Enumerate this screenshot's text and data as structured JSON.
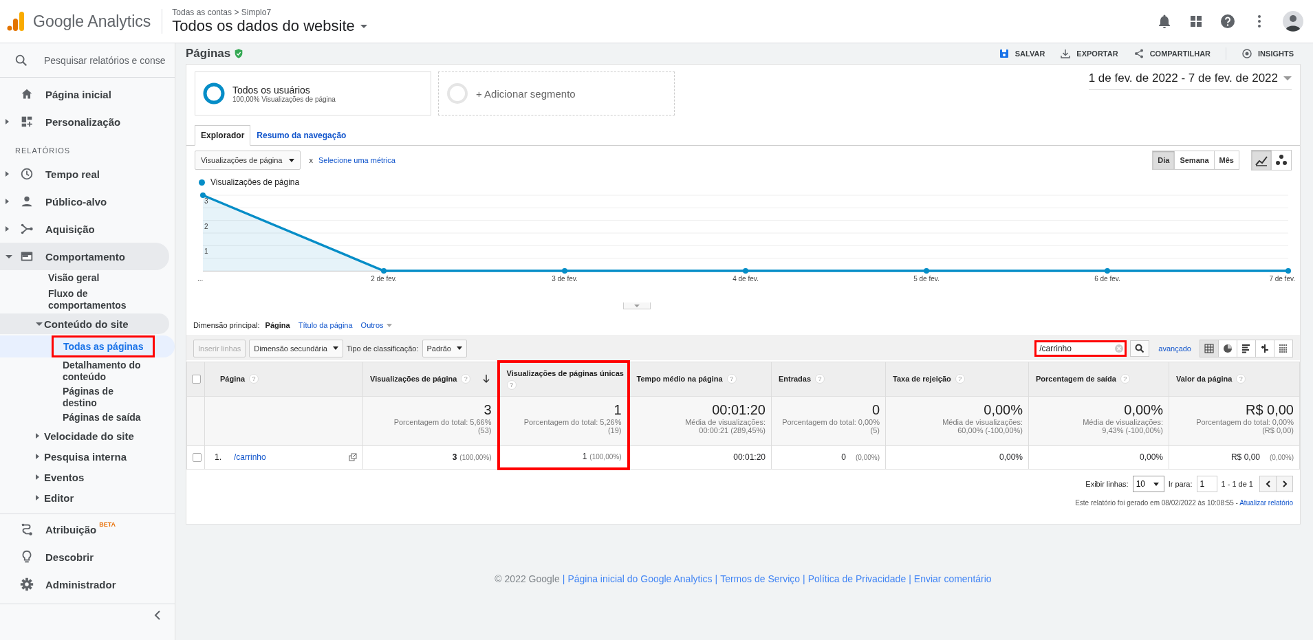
{
  "header": {
    "product": "Google Analytics",
    "breadcrumb": "Todas as contas > Simplo7",
    "view_title": "Todos os dados do website"
  },
  "sidebar": {
    "search": {
      "placeholder": "Pesquisar relatórios e conse"
    },
    "nav": [
      {
        "label": "Página inicial"
      },
      {
        "label": "Personalização",
        "expanded": false
      }
    ],
    "reports_heading": "RELATÓRIOS",
    "reports": [
      {
        "label": "Tempo real",
        "expanded": false
      },
      {
        "label": "Público-alvo",
        "expanded": false
      },
      {
        "label": "Aquisição",
        "expanded": false
      },
      {
        "label": "Comportamento",
        "expanded": true,
        "children": [
          {
            "label": "Visão geral",
            "selected": false
          },
          {
            "label": "Fluxo de comportamentos",
            "selected": false
          },
          {
            "label": "Conteúdo do site",
            "expanded": true,
            "children": [
              {
                "label": "Todas as páginas",
                "selected": true,
                "highlighted": true
              },
              {
                "label": "Detalhamento do conteúdo",
                "selected": false,
                "highlighted": false
              },
              {
                "label": "Páginas de destino",
                "selected": false,
                "highlighted": false
              },
              {
                "label": "Páginas de saída",
                "selected": false,
                "highlighted": false
              }
            ]
          },
          {
            "label": "Velocidade do site",
            "expanded": false
          },
          {
            "label": "Pesquisa interna",
            "expanded": false
          },
          {
            "label": "Eventos",
            "expanded": false
          },
          {
            "label": "Editor",
            "expanded": false
          }
        ]
      }
    ],
    "bottom": [
      {
        "label": "Atribuição",
        "badge": "BETA"
      },
      {
        "label": "Descobrir"
      },
      {
        "label": "Administrador"
      }
    ]
  },
  "report": {
    "title": "Páginas",
    "verified": true,
    "actions": [
      {
        "label": "SALVAR"
      },
      {
        "label": "EXPORTAR"
      },
      {
        "label": "COMPARTILHAR"
      },
      {
        "label": "INSIGHTS"
      }
    ]
  },
  "segments": [
    {
      "kind": "active",
      "name": "Todos os usuários",
      "detail": "100,00% Visualizações de página"
    },
    {
      "kind": "add",
      "name": "+ Adicionar segmento"
    }
  ],
  "date_range": "1 de fev. de 2022 - 7 de fev. de 2022",
  "tabs": [
    {
      "label": "Explorador",
      "selected": true
    },
    {
      "label": "Resumo da navegação",
      "selected": false
    }
  ],
  "metric_selector": {
    "value": "Visualizações de página",
    "remove": "x",
    "add_link": "Selecione uma métrica"
  },
  "granularity": [
    {
      "label": "Dia",
      "selected": true
    },
    {
      "label": "Semana",
      "selected": false
    },
    {
      "label": "Mês",
      "selected": false
    }
  ],
  "chart_modes": [
    {
      "selected": true
    },
    {
      "selected": false
    }
  ],
  "chart": {
    "chart_data": {
      "type": "area",
      "categories": [
        "...",
        "2 de fev.",
        "3 de fev.",
        "4 de fev.",
        "5 de fev.",
        "6 de fev.",
        "7 de fev."
      ],
      "yticks": [
        1,
        2,
        3
      ],
      "ylim": [
        0,
        3
      ],
      "series": [
        {
          "name": "Visualizações de página",
          "color": "#058dc7",
          "values": [
            3,
            0,
            0,
            0,
            0,
            0,
            0
          ]
        }
      ]
    }
  },
  "dimension": {
    "label": "Dimensão principal:",
    "options": [
      {
        "label": "Página",
        "selected": true
      },
      {
        "label": "Título da página",
        "selected": false
      },
      {
        "label": "Outros",
        "selected": false
      }
    ]
  },
  "toolbar": {
    "insert_rows": {
      "label": "Inserir linhas",
      "disabled": true
    },
    "secondary_dimension": "Dimensão secundária",
    "sort_label": "Tipo de classificação:",
    "sort_value": "Padrão",
    "search": {
      "value": "/carrinho",
      "highlighted": true
    },
    "advanced": "avançado",
    "views": [
      {
        "selected": true
      },
      {
        "selected": false
      },
      {
        "selected": false
      },
      {
        "selected": false
      },
      {
        "selected": false
      }
    ]
  },
  "table": {
    "columns": [
      {
        "label": "Página",
        "help": "?",
        "sorted": false,
        "highlighted": false
      },
      {
        "label": "Visualizações de página",
        "help": "?",
        "sorted": true,
        "highlighted": false
      },
      {
        "label": "Visualizações de páginas únicas",
        "help": "?",
        "sorted": false,
        "highlighted": true
      },
      {
        "label": "Tempo médio na página",
        "help": "?",
        "sorted": false,
        "highlighted": false
      },
      {
        "label": "Entradas",
        "help": "?",
        "sorted": false,
        "highlighted": false
      },
      {
        "label": "Taxa de rejeição",
        "help": "?",
        "sorted": false,
        "highlighted": false
      },
      {
        "label": "Porcentagem de saída",
        "help": "?",
        "sorted": false,
        "highlighted": false
      },
      {
        "label": "Valor da página",
        "help": "?",
        "sorted": false,
        "highlighted": false
      }
    ],
    "select_all_checked": false,
    "totals": [
      {
        "value": "3",
        "detail": "Porcentagem do total: 5,66% (53)"
      },
      {
        "value": "1",
        "detail": "Porcentagem do total: 5,26% (19)"
      },
      {
        "value": "00:01:20",
        "detail": "Média de visualizações: 00:00:21 (289,45%)"
      },
      {
        "value": "0",
        "detail": "Porcentagem do total: 0,00% (5)"
      },
      {
        "value": "0,00%",
        "detail": "Média de visualizações: 60,00% (-100,00%)"
      },
      {
        "value": "0,00%",
        "detail": "Média de visualizações: 9,43% (-100,00%)"
      },
      {
        "value": "R$ 0,00",
        "detail": "Porcentagem do total: 0,00% (R$ 0,00)"
      }
    ],
    "rows": [
      {
        "checked": false,
        "cells": [
          {
            "kind": "page",
            "number": "1.",
            "value": "/carrinho",
            "bold": false
          },
          {
            "value": "3",
            "share": "(100,00%)",
            "bold": true
          },
          {
            "value": "1",
            "share": "(100,00%)",
            "bold": false
          },
          {
            "value": "00:01:20",
            "bold": false
          },
          {
            "value": "0",
            "share": "(0,00%)",
            "bold": false
          },
          {
            "value": "0,00%",
            "bold": false
          },
          {
            "value": "0,00%",
            "bold": false
          },
          {
            "value": "R$ 0,00",
            "share": "(0,00%)",
            "bold": false
          }
        ]
      }
    ]
  },
  "pagination": {
    "rows_label": "Exibir linhas:",
    "rows_value": "10",
    "goto_label": "Ir para:",
    "goto_value": "1",
    "range": "1 - 1 de 1"
  },
  "report_note": {
    "text": "Este relatório foi gerado em 08/02/2022 às 10:08:55 - ",
    "link": "Atualizar relatório"
  },
  "footer": {
    "copyright": "© 2022 Google",
    "separator": "|",
    "links": [
      "Página inicial do Google Analytics",
      "Termos de Serviço",
      "Política de Privacidade",
      "Enviar comentário"
    ]
  }
}
